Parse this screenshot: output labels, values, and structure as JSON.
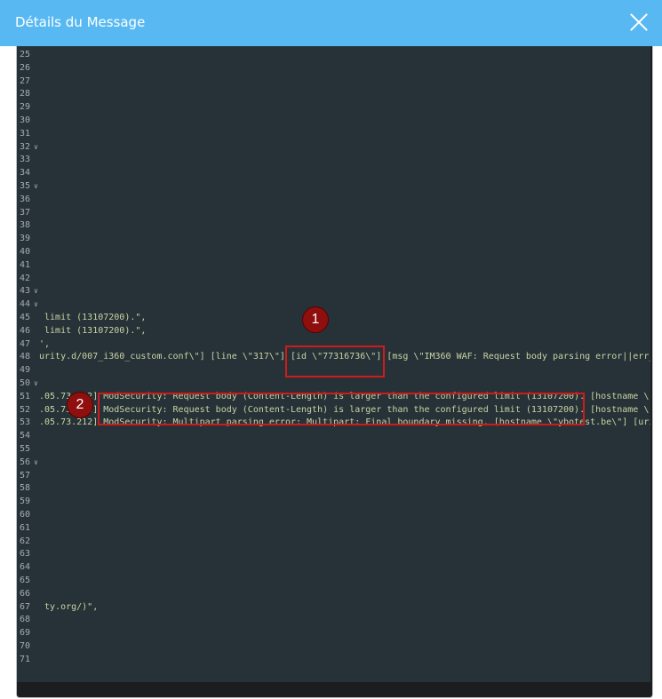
{
  "modal": {
    "title": "Détails du Message"
  },
  "editor": {
    "lines": [
      {
        "n": "25",
        "fold": false,
        "text": ""
      },
      {
        "n": "26",
        "fold": false,
        "text": ""
      },
      {
        "n": "27",
        "fold": false,
        "text": ""
      },
      {
        "n": "28",
        "fold": false,
        "text": ""
      },
      {
        "n": "29",
        "fold": false,
        "text": ""
      },
      {
        "n": "30",
        "fold": false,
        "text": ""
      },
      {
        "n": "31",
        "fold": false,
        "text": ""
      },
      {
        "n": "32",
        "fold": true,
        "text": ""
      },
      {
        "n": "33",
        "fold": false,
        "text": ""
      },
      {
        "n": "34",
        "fold": false,
        "text": ""
      },
      {
        "n": "35",
        "fold": true,
        "text": ""
      },
      {
        "n": "36",
        "fold": false,
        "text": ""
      },
      {
        "n": "37",
        "fold": false,
        "text": ""
      },
      {
        "n": "38",
        "fold": false,
        "text": ""
      },
      {
        "n": "39",
        "fold": false,
        "text": ""
      },
      {
        "n": "40",
        "fold": false,
        "text": ""
      },
      {
        "n": "41",
        "fold": false,
        "text": ""
      },
      {
        "n": "42",
        "fold": false,
        "text": ""
      },
      {
        "n": "43",
        "fold": true,
        "text": ""
      },
      {
        "n": "44",
        "fold": true,
        "text": ""
      },
      {
        "n": "45",
        "fold": false,
        "text": " limit (13107200).\","
      },
      {
        "n": "46",
        "fold": false,
        "text": " limit (13107200).\","
      },
      {
        "n": "47",
        "fold": false,
        "text": "',"
      },
      {
        "n": "48",
        "fold": false,
        "text": "urity.d/007_i360_custom.conf\\\"] [line \\\"317\\\"] [id \\\"77316736\\\"] [msg \\\"IM360 WAF: Request body parsing error||err_"
      },
      {
        "n": "49",
        "fold": false,
        "text": ""
      },
      {
        "n": "50",
        "fold": true,
        "text": ""
      },
      {
        "n": "51",
        "fold": false,
        "text": ".05.73.212] ModSecurity: Request body (Content-Length) is larger than the configured limit (13107200). [hostname \\\""
      },
      {
        "n": "52",
        "fold": false,
        "text": ".05.73.212] ModSecurity: Request body (Content-Length) is larger than the configured limit (13107200). [hostname \\\""
      },
      {
        "n": "53",
        "fold": false,
        "text": ".05.73.212] ModSecurity: Multipart parsing error: Multipart: Final boundary missing. [hostname \\\"ybotest.be\\\"] [uri"
      },
      {
        "n": "54",
        "fold": false,
        "text": ""
      },
      {
        "n": "55",
        "fold": false,
        "text": ""
      },
      {
        "n": "56",
        "fold": true,
        "text": ""
      },
      {
        "n": "57",
        "fold": false,
        "text": ""
      },
      {
        "n": "58",
        "fold": false,
        "text": ""
      },
      {
        "n": "59",
        "fold": false,
        "text": ""
      },
      {
        "n": "60",
        "fold": false,
        "text": ""
      },
      {
        "n": "61",
        "fold": false,
        "text": ""
      },
      {
        "n": "62",
        "fold": false,
        "text": ""
      },
      {
        "n": "63",
        "fold": false,
        "text": ""
      },
      {
        "n": "64",
        "fold": false,
        "text": ""
      },
      {
        "n": "65",
        "fold": false,
        "text": ""
      },
      {
        "n": "66",
        "fold": false,
        "text": ""
      },
      {
        "n": "67",
        "fold": false,
        "text": " ty.org/)\","
      },
      {
        "n": "68",
        "fold": false,
        "text": ""
      },
      {
        "n": "69",
        "fold": false,
        "text": ""
      },
      {
        "n": "70",
        "fold": false,
        "text": ""
      },
      {
        "n": "71",
        "fold": false,
        "text": ""
      }
    ]
  },
  "annotations": {
    "badge1": "1",
    "badge2": "2",
    "highlight_color": "#d11b1b"
  }
}
